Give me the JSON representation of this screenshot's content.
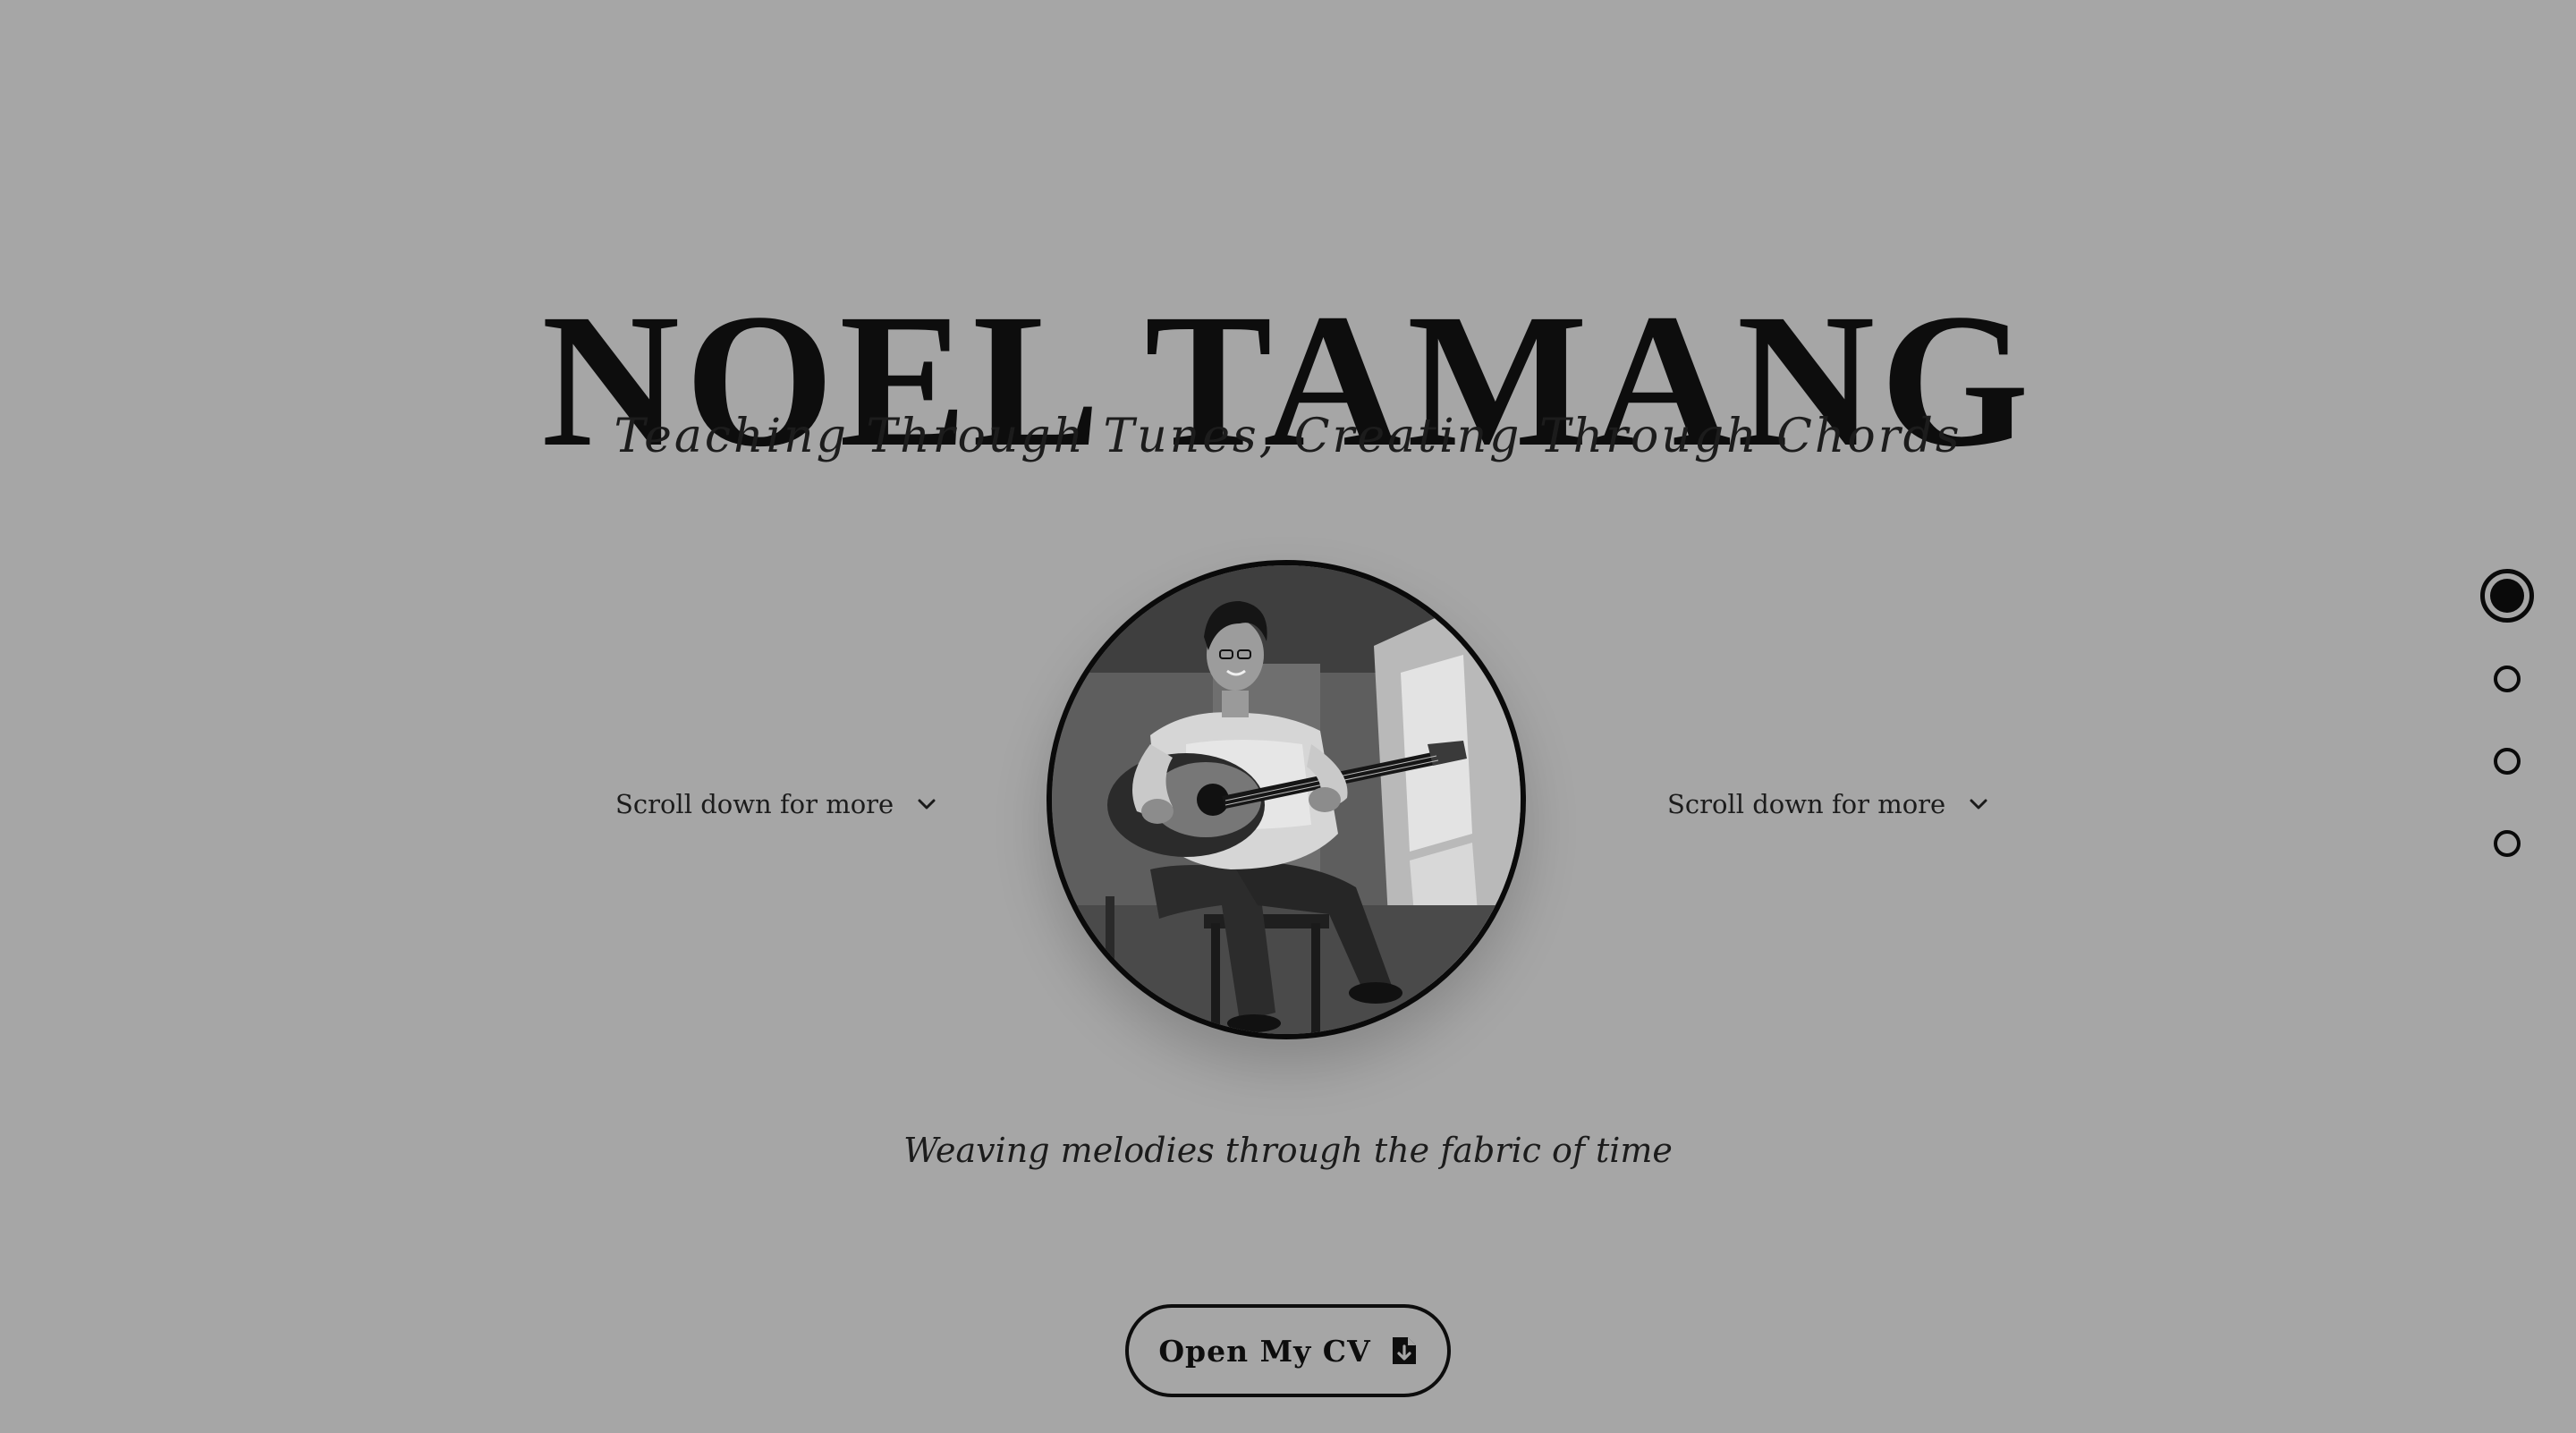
{
  "hero": {
    "name": "NOEL TAMANG",
    "tagline": "Teaching Through Tunes, Creating Through Chords",
    "caption": "Weaving melodies through the fabric of time"
  },
  "scroll_hint": {
    "left_text": "Scroll down for more",
    "right_text": "Scroll down for more",
    "icon": "chevron-down-icon"
  },
  "portrait": {
    "alt": "Noel Tamang playing acoustic guitar"
  },
  "cv_button": {
    "label": "Open My CV",
    "icon": "file-download-icon"
  },
  "section_nav": {
    "dots": 4,
    "active_index": 0
  },
  "colors": {
    "background": "#a6a6a6",
    "ink": "#0d0d0d"
  }
}
